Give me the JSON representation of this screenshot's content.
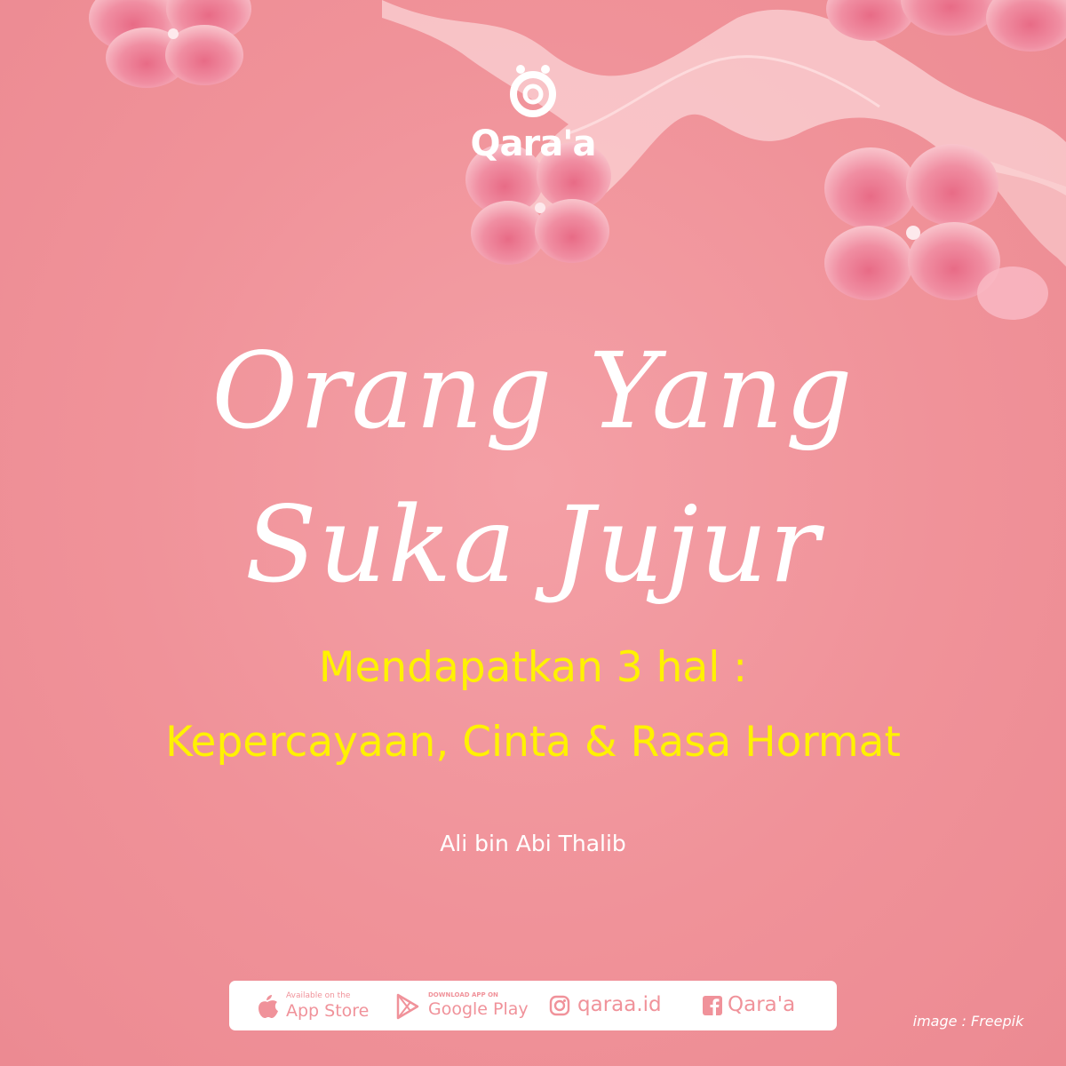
{
  "brand": {
    "name": "Qara'a"
  },
  "quote": {
    "title_line1": "Orang Yang",
    "title_line2": "Suka Jujur",
    "subtitle_line1": "Mendapatkan 3 hal :",
    "subtitle_line2": "Kepercayaan, Cinta & Rasa Hormat",
    "author": "Ali bin Abi Thalib"
  },
  "footer": {
    "app_store": {
      "small": "Available on the",
      "big": "App Store",
      "icon": "apple-icon"
    },
    "google_play": {
      "small": "DOWNLOAD APP ON",
      "big": "Google Play",
      "icon": "play-icon"
    },
    "instagram": {
      "label": "qaraa.id",
      "icon": "instagram-icon"
    },
    "facebook": {
      "label": "Qara'a",
      "icon": "facebook-icon"
    }
  },
  "credit": "image : Freepik",
  "colors": {
    "background": "#f09299",
    "accent_yellow": "#fff200",
    "text_white": "#ffffff",
    "footer_icon": "#f0929a"
  }
}
